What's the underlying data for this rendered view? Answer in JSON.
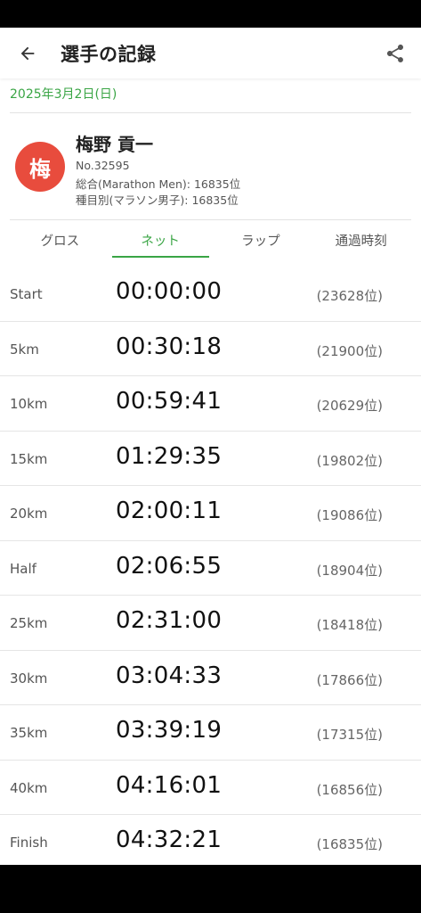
{
  "header": {
    "title": "選手の記録",
    "back_icon": "arrow-back-icon",
    "share_icon": "share-icon"
  },
  "date": "2025年3月2日(日)",
  "runner": {
    "avatar_char": "梅",
    "avatar_color": "#e84c3d",
    "name": "梅野 貢一",
    "number": "No.32595",
    "overall": "総合(Marathon Men): 16835位",
    "category": "種目別(マラソン男子): 16835位"
  },
  "tabs": [
    {
      "label": "グロス",
      "active": false
    },
    {
      "label": "ネット",
      "active": true
    },
    {
      "label": "ラップ",
      "active": false
    },
    {
      "label": "通過時刻",
      "active": false
    }
  ],
  "splits": [
    {
      "point": "Start",
      "time": "00:00:00",
      "rank": "(23628位)"
    },
    {
      "point": "5km",
      "time": "00:30:18",
      "rank": "(21900位)"
    },
    {
      "point": "10km",
      "time": "00:59:41",
      "rank": "(20629位)"
    },
    {
      "point": "15km",
      "time": "01:29:35",
      "rank": "(19802位)"
    },
    {
      "point": "20km",
      "time": "02:00:11",
      "rank": "(19086位)"
    },
    {
      "point": "Half",
      "time": "02:06:55",
      "rank": "(18904位)"
    },
    {
      "point": "25km",
      "time": "02:31:00",
      "rank": "(18418位)"
    },
    {
      "point": "30km",
      "time": "03:04:33",
      "rank": "(17866位)"
    },
    {
      "point": "35km",
      "time": "03:39:19",
      "rank": "(17315位)"
    },
    {
      "point": "40km",
      "time": "04:16:01",
      "rank": "(16856位)"
    },
    {
      "point": "Finish",
      "time": "04:32:21",
      "rank": "(16835位)"
    }
  ],
  "colors": {
    "accent": "#3aa545"
  }
}
